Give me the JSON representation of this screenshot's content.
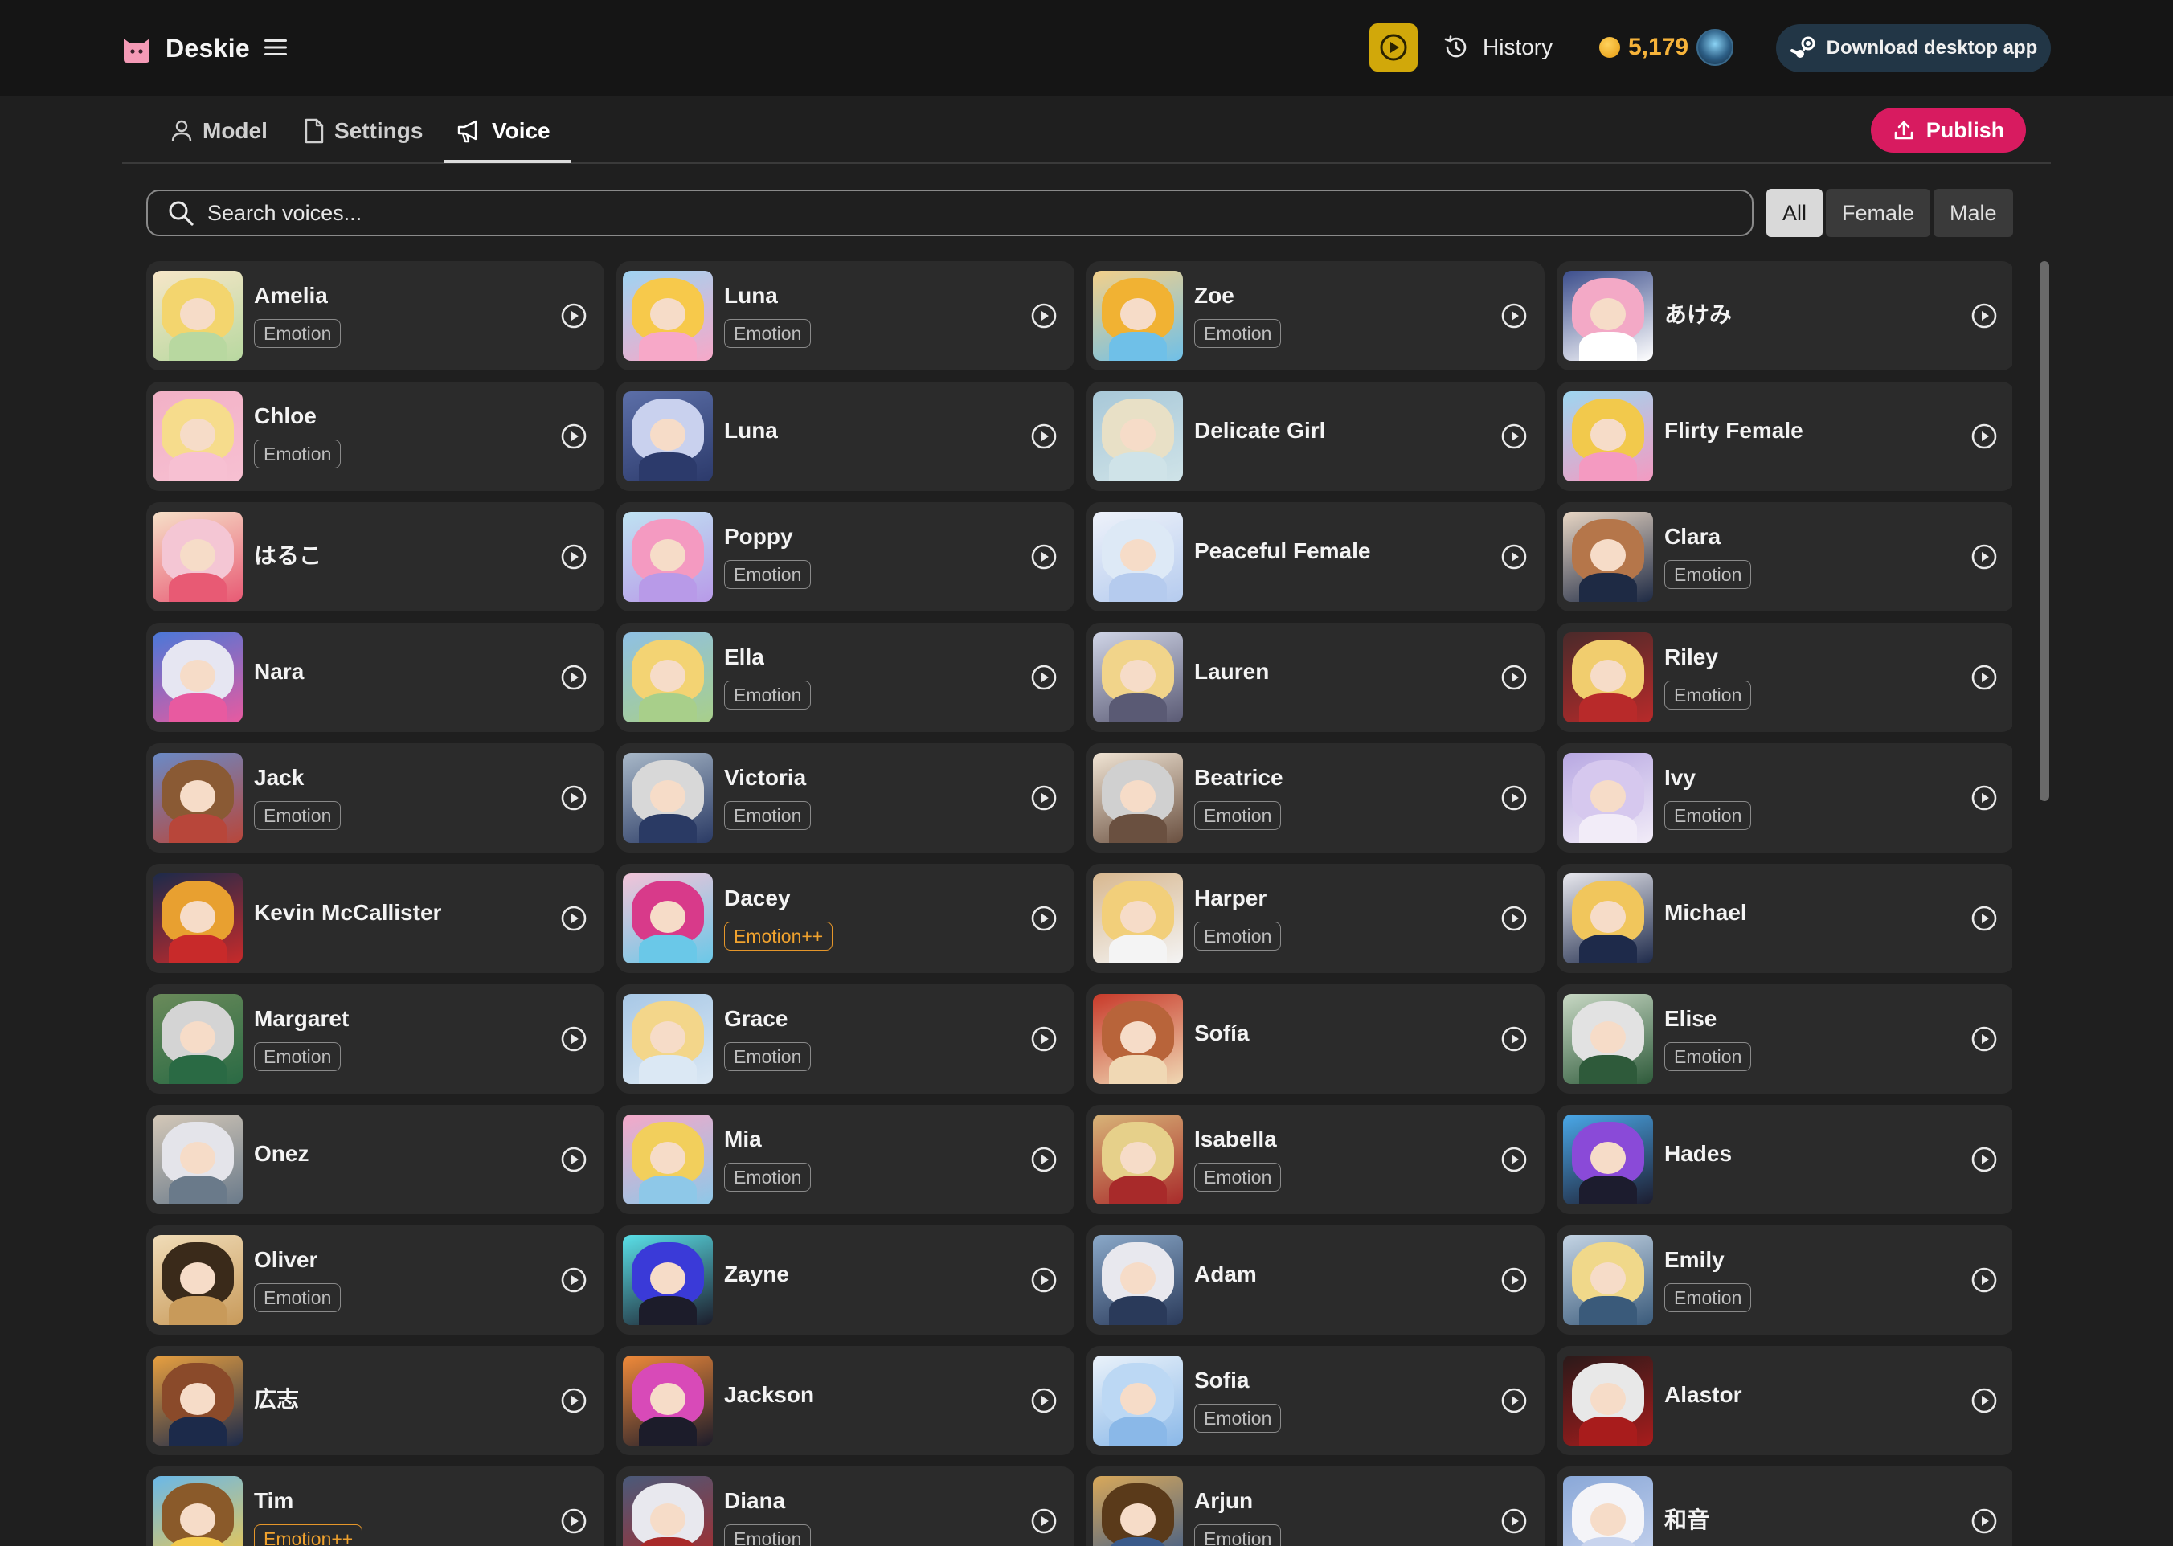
{
  "brand": {
    "name": "Deskie"
  },
  "header": {
    "history_label": "History",
    "coins": "5,179",
    "download_label": "Download desktop app"
  },
  "tabs": [
    {
      "label": "Model",
      "icon": "user-icon"
    },
    {
      "label": "Settings",
      "icon": "file-icon"
    },
    {
      "label": "Voice",
      "icon": "megaphone-icon",
      "active": true
    }
  ],
  "publish_label": "Publish",
  "search": {
    "placeholder": "Search voices...",
    "value": ""
  },
  "filters": [
    {
      "label": "All",
      "active": true
    },
    {
      "label": "Female"
    },
    {
      "label": "Male"
    }
  ],
  "colors": {
    "accent": "#d81b60",
    "coin": "#f6b33a",
    "emission_plus": "#f0a22e"
  },
  "voices": [
    {
      "name": "Amelia",
      "badge": "Emotion",
      "palette": [
        "#f3d56e",
        "#b8d8a0",
        "#f7e6c8"
      ]
    },
    {
      "name": "Luna",
      "badge": "Emotion",
      "palette": [
        "#f7c94b",
        "#f7a8c8",
        "#9fd4f2"
      ]
    },
    {
      "name": "Zoe",
      "badge": "Emotion",
      "palette": [
        "#f1b233",
        "#6fc0e8",
        "#f3d08a"
      ]
    },
    {
      "name": "あけみ",
      "badge": "",
      "palette": [
        "#f3a9c6",
        "#ffffff",
        "#3c4e8c"
      ]
    },
    {
      "name": "Chloe",
      "badge": "Emotion",
      "palette": [
        "#f6dc8c",
        "#f7c0d2",
        "#f2b1c6"
      ]
    },
    {
      "name": "Luna",
      "badge": "",
      "palette": [
        "#c9d1ee",
        "#2c3a6b",
        "#5c6fa8"
      ]
    },
    {
      "name": "Delicate Girl",
      "badge": "",
      "palette": [
        "#e8e0c6",
        "#cfe3e8",
        "#a8c8d8"
      ]
    },
    {
      "name": "Flirty Female",
      "badge": "",
      "palette": [
        "#f2c94c",
        "#f49ac1",
        "#9ed6f0"
      ]
    },
    {
      "name": "はるこ",
      "badge": "",
      "palette": [
        "#f4c6d4",
        "#e85a74",
        "#f6e0c8"
      ]
    },
    {
      "name": "Poppy",
      "badge": "Emotion",
      "palette": [
        "#f49ac1",
        "#b89ae8",
        "#bfe3f2"
      ]
    },
    {
      "name": "Peaceful Female",
      "badge": "",
      "palette": [
        "#dde9f6",
        "#b5cbee",
        "#eef2fa"
      ]
    },
    {
      "name": "Clara",
      "badge": "Emotion",
      "palette": [
        "#b5764a",
        "#1e2a44",
        "#e8d6c4"
      ]
    },
    {
      "name": "Nara",
      "badge": "",
      "palette": [
        "#e6e6f2",
        "#e85aa0",
        "#4a78d8"
      ]
    },
    {
      "name": "Ella",
      "badge": "Emotion",
      "palette": [
        "#f3d373",
        "#a8cf8a",
        "#8fc0e4"
      ]
    },
    {
      "name": "Lauren",
      "badge": "",
      "palette": [
        "#f1d48a",
        "#5a5a74",
        "#cfd4e6"
      ]
    },
    {
      "name": "Riley",
      "badge": "Emotion",
      "palette": [
        "#f1cd6e",
        "#b82a2a",
        "#4a2a2a"
      ]
    },
    {
      "name": "Jack",
      "badge": "Emotion",
      "palette": [
        "#8a5a34",
        "#b8463a",
        "#6a8ac6"
      ]
    },
    {
      "name": "Victoria",
      "badge": "Emotion",
      "palette": [
        "#d8d8d8",
        "#2a3a64",
        "#a8b8c8"
      ]
    },
    {
      "name": "Beatrice",
      "badge": "Emotion",
      "palette": [
        "#d0d0d0",
        "#6a5040",
        "#f0e4d4"
      ]
    },
    {
      "name": "Ivy",
      "badge": "Emotion",
      "palette": [
        "#d6c8ee",
        "#f2ecf8",
        "#b8a8e2"
      ]
    },
    {
      "name": "Kevin McCallister",
      "badge": "",
      "palette": [
        "#e8a030",
        "#c82a2a",
        "#1c2a4a"
      ]
    },
    {
      "name": "Dacey",
      "badge": "Emotion++",
      "palette": [
        "#d83a8a",
        "#6ac8e8",
        "#f2c4d8"
      ]
    },
    {
      "name": "Harper",
      "badge": "Emotion",
      "palette": [
        "#f2cf7a",
        "#f4f4f4",
        "#d8b890"
      ]
    },
    {
      "name": "Michael",
      "badge": "",
      "palette": [
        "#f1c65c",
        "#1e2a4a",
        "#e8e8ee"
      ]
    },
    {
      "name": "Margaret",
      "badge": "Emotion",
      "palette": [
        "#d4d4d4",
        "#2a6a44",
        "#6a8a5a"
      ]
    },
    {
      "name": "Grace",
      "badge": "Emotion",
      "palette": [
        "#f3d68a",
        "#dbe8f4",
        "#a8c8e6"
      ]
    },
    {
      "name": "Sofía",
      "badge": "",
      "palette": [
        "#b8643a",
        "#f0d8b4",
        "#c83a2a"
      ]
    },
    {
      "name": "Elise",
      "badge": "Emotion",
      "palette": [
        "#e2e2e2",
        "#2e5a3a",
        "#c8d8c4"
      ]
    },
    {
      "name": "Onez",
      "badge": "",
      "palette": [
        "#e4e4ea",
        "#6a7a8a",
        "#d4c8b8"
      ]
    },
    {
      "name": "Mia",
      "badge": "Emotion",
      "palette": [
        "#f2cf5c",
        "#8ec8e8",
        "#f4a8c8"
      ]
    },
    {
      "name": "Isabella",
      "badge": "Emotion",
      "palette": [
        "#e6d08a",
        "#a82a2a",
        "#d8b478"
      ]
    },
    {
      "name": "Hades",
      "badge": "",
      "palette": [
        "#8a4ad8",
        "#1c1c2e",
        "#4aa8e8"
      ]
    },
    {
      "name": "Oliver",
      "badge": "Emotion",
      "palette": [
        "#3a2a1a",
        "#c89a5a",
        "#f0dcb8"
      ]
    },
    {
      "name": "Zayne",
      "badge": "",
      "palette": [
        "#3a3ad8",
        "#1c1c2a",
        "#5ae0e8"
      ]
    },
    {
      "name": "Adam",
      "badge": "",
      "palette": [
        "#e8e8ee",
        "#2a3a5a",
        "#8aa8c8"
      ]
    },
    {
      "name": "Emily",
      "badge": "Emotion",
      "palette": [
        "#f0d88a",
        "#3a5a7a",
        "#c4d4e4"
      ]
    },
    {
      "name": "広志",
      "badge": "",
      "palette": [
        "#8a4a2a",
        "#1c2a4a",
        "#e8a040"
      ]
    },
    {
      "name": "Jackson",
      "badge": "",
      "palette": [
        "#d84ab8",
        "#1c1c2a",
        "#f08a3a"
      ]
    },
    {
      "name": "Sofia",
      "badge": "Emotion",
      "palette": [
        "#bcd8f4",
        "#8ab8e8",
        "#eaf2fa"
      ]
    },
    {
      "name": "Alastor",
      "badge": "",
      "palette": [
        "#e8e8e8",
        "#a81c1c",
        "#2a1a1a"
      ]
    },
    {
      "name": "Tim",
      "badge": "Emotion++",
      "palette": [
        "#8a5a2a",
        "#f2c84a",
        "#6ab8e8"
      ]
    },
    {
      "name": "Diana",
      "badge": "Emotion",
      "palette": [
        "#e8e8ee",
        "#a82a2a",
        "#4a5a7a"
      ]
    },
    {
      "name": "Arjun",
      "badge": "Emotion",
      "palette": [
        "#5a3a1a",
        "#3a5a8a",
        "#d8a85a"
      ]
    },
    {
      "name": "和音",
      "badge": "",
      "palette": [
        "#f4f4f8",
        "#c8d4ee",
        "#8aa8d8"
      ]
    }
  ]
}
